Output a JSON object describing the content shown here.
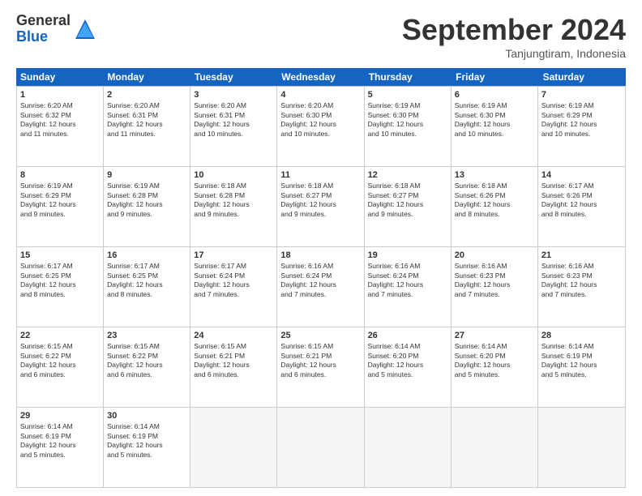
{
  "logo": {
    "general": "General",
    "blue": "Blue"
  },
  "header": {
    "title": "September 2024",
    "location": "Tanjungtiram, Indonesia"
  },
  "weekdays": [
    "Sunday",
    "Monday",
    "Tuesday",
    "Wednesday",
    "Thursday",
    "Friday",
    "Saturday"
  ],
  "rows": [
    [
      {
        "day": "1",
        "lines": [
          "Sunrise: 6:20 AM",
          "Sunset: 6:32 PM",
          "Daylight: 12 hours",
          "and 11 minutes."
        ]
      },
      {
        "day": "2",
        "lines": [
          "Sunrise: 6:20 AM",
          "Sunset: 6:31 PM",
          "Daylight: 12 hours",
          "and 11 minutes."
        ]
      },
      {
        "day": "3",
        "lines": [
          "Sunrise: 6:20 AM",
          "Sunset: 6:31 PM",
          "Daylight: 12 hours",
          "and 10 minutes."
        ]
      },
      {
        "day": "4",
        "lines": [
          "Sunrise: 6:20 AM",
          "Sunset: 6:30 PM",
          "Daylight: 12 hours",
          "and 10 minutes."
        ]
      },
      {
        "day": "5",
        "lines": [
          "Sunrise: 6:19 AM",
          "Sunset: 6:30 PM",
          "Daylight: 12 hours",
          "and 10 minutes."
        ]
      },
      {
        "day": "6",
        "lines": [
          "Sunrise: 6:19 AM",
          "Sunset: 6:30 PM",
          "Daylight: 12 hours",
          "and 10 minutes."
        ]
      },
      {
        "day": "7",
        "lines": [
          "Sunrise: 6:19 AM",
          "Sunset: 6:29 PM",
          "Daylight: 12 hours",
          "and 10 minutes."
        ]
      }
    ],
    [
      {
        "day": "8",
        "lines": [
          "Sunrise: 6:19 AM",
          "Sunset: 6:29 PM",
          "Daylight: 12 hours",
          "and 9 minutes."
        ]
      },
      {
        "day": "9",
        "lines": [
          "Sunrise: 6:19 AM",
          "Sunset: 6:28 PM",
          "Daylight: 12 hours",
          "and 9 minutes."
        ]
      },
      {
        "day": "10",
        "lines": [
          "Sunrise: 6:18 AM",
          "Sunset: 6:28 PM",
          "Daylight: 12 hours",
          "and 9 minutes."
        ]
      },
      {
        "day": "11",
        "lines": [
          "Sunrise: 6:18 AM",
          "Sunset: 6:27 PM",
          "Daylight: 12 hours",
          "and 9 minutes."
        ]
      },
      {
        "day": "12",
        "lines": [
          "Sunrise: 6:18 AM",
          "Sunset: 6:27 PM",
          "Daylight: 12 hours",
          "and 9 minutes."
        ]
      },
      {
        "day": "13",
        "lines": [
          "Sunrise: 6:18 AM",
          "Sunset: 6:26 PM",
          "Daylight: 12 hours",
          "and 8 minutes."
        ]
      },
      {
        "day": "14",
        "lines": [
          "Sunrise: 6:17 AM",
          "Sunset: 6:26 PM",
          "Daylight: 12 hours",
          "and 8 minutes."
        ]
      }
    ],
    [
      {
        "day": "15",
        "lines": [
          "Sunrise: 6:17 AM",
          "Sunset: 6:25 PM",
          "Daylight: 12 hours",
          "and 8 minutes."
        ]
      },
      {
        "day": "16",
        "lines": [
          "Sunrise: 6:17 AM",
          "Sunset: 6:25 PM",
          "Daylight: 12 hours",
          "and 8 minutes."
        ]
      },
      {
        "day": "17",
        "lines": [
          "Sunrise: 6:17 AM",
          "Sunset: 6:24 PM",
          "Daylight: 12 hours",
          "and 7 minutes."
        ]
      },
      {
        "day": "18",
        "lines": [
          "Sunrise: 6:16 AM",
          "Sunset: 6:24 PM",
          "Daylight: 12 hours",
          "and 7 minutes."
        ]
      },
      {
        "day": "19",
        "lines": [
          "Sunrise: 6:16 AM",
          "Sunset: 6:24 PM",
          "Daylight: 12 hours",
          "and 7 minutes."
        ]
      },
      {
        "day": "20",
        "lines": [
          "Sunrise: 6:16 AM",
          "Sunset: 6:23 PM",
          "Daylight: 12 hours",
          "and 7 minutes."
        ]
      },
      {
        "day": "21",
        "lines": [
          "Sunrise: 6:16 AM",
          "Sunset: 6:23 PM",
          "Daylight: 12 hours",
          "and 7 minutes."
        ]
      }
    ],
    [
      {
        "day": "22",
        "lines": [
          "Sunrise: 6:15 AM",
          "Sunset: 6:22 PM",
          "Daylight: 12 hours",
          "and 6 minutes."
        ]
      },
      {
        "day": "23",
        "lines": [
          "Sunrise: 6:15 AM",
          "Sunset: 6:22 PM",
          "Daylight: 12 hours",
          "and 6 minutes."
        ]
      },
      {
        "day": "24",
        "lines": [
          "Sunrise: 6:15 AM",
          "Sunset: 6:21 PM",
          "Daylight: 12 hours",
          "and 6 minutes."
        ]
      },
      {
        "day": "25",
        "lines": [
          "Sunrise: 6:15 AM",
          "Sunset: 6:21 PM",
          "Daylight: 12 hours",
          "and 6 minutes."
        ]
      },
      {
        "day": "26",
        "lines": [
          "Sunrise: 6:14 AM",
          "Sunset: 6:20 PM",
          "Daylight: 12 hours",
          "and 5 minutes."
        ]
      },
      {
        "day": "27",
        "lines": [
          "Sunrise: 6:14 AM",
          "Sunset: 6:20 PM",
          "Daylight: 12 hours",
          "and 5 minutes."
        ]
      },
      {
        "day": "28",
        "lines": [
          "Sunrise: 6:14 AM",
          "Sunset: 6:19 PM",
          "Daylight: 12 hours",
          "and 5 minutes."
        ]
      }
    ],
    [
      {
        "day": "29",
        "lines": [
          "Sunrise: 6:14 AM",
          "Sunset: 6:19 PM",
          "Daylight: 12 hours",
          "and 5 minutes."
        ]
      },
      {
        "day": "30",
        "lines": [
          "Sunrise: 6:14 AM",
          "Sunset: 6:19 PM",
          "Daylight: 12 hours",
          "and 5 minutes."
        ]
      },
      {
        "day": "",
        "lines": []
      },
      {
        "day": "",
        "lines": []
      },
      {
        "day": "",
        "lines": []
      },
      {
        "day": "",
        "lines": []
      },
      {
        "day": "",
        "lines": []
      }
    ]
  ]
}
